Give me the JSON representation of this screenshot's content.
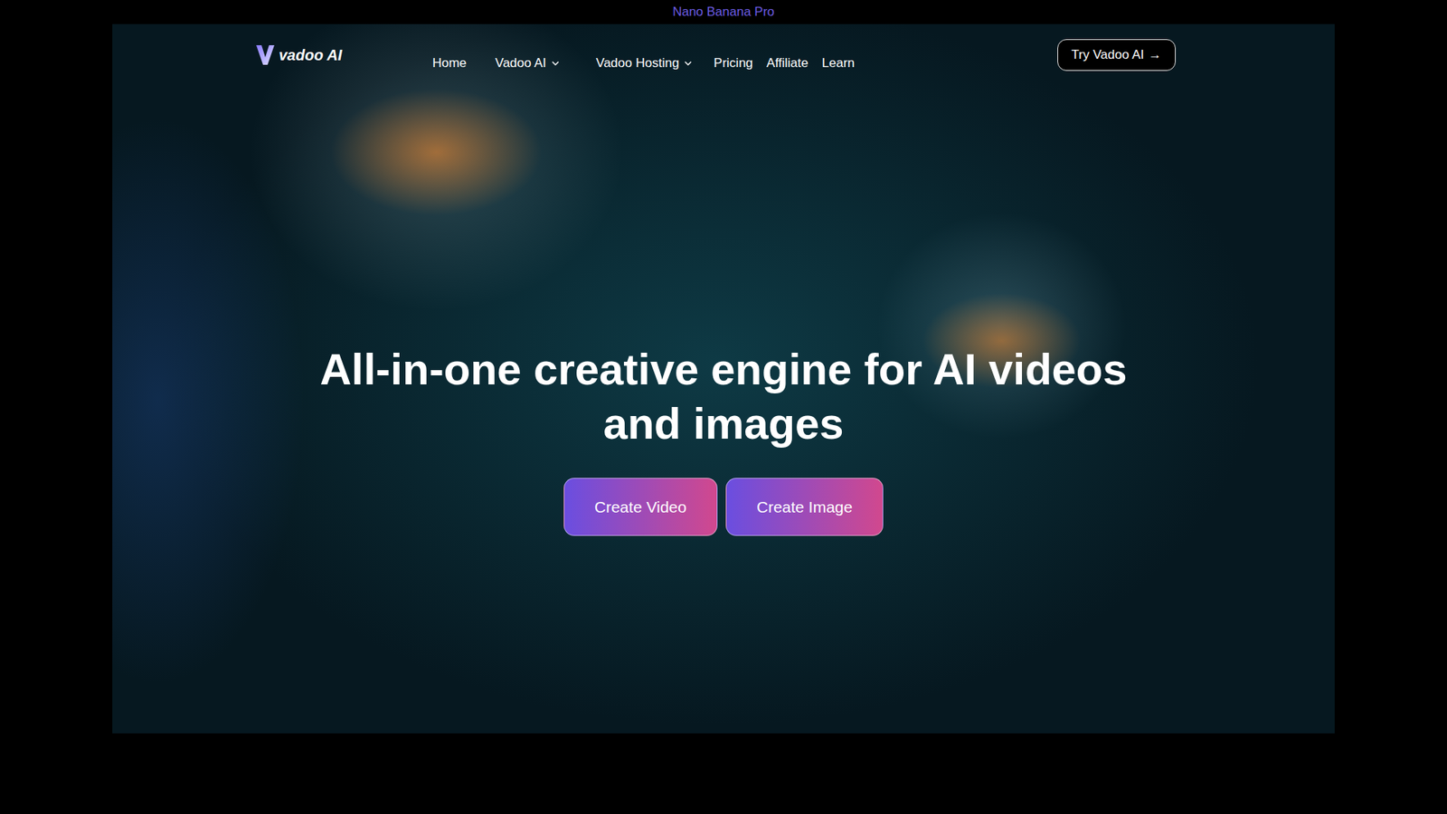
{
  "banner": {
    "text": "Nano Banana Pro"
  },
  "logo": {
    "text": "vadoo AI"
  },
  "nav": {
    "items": [
      {
        "label": "Home",
        "kind": "link"
      },
      {
        "label": "Vadoo AI",
        "kind": "dropdown"
      },
      {
        "label": "Vadoo Hosting",
        "kind": "dropdown"
      },
      {
        "label": "Pricing",
        "kind": "link"
      },
      {
        "label": "Affiliate",
        "kind": "link"
      },
      {
        "label": "Learn",
        "kind": "link"
      }
    ]
  },
  "cta": {
    "label": "Try Vadoo AI",
    "icon": "→"
  },
  "hero": {
    "title_lines": [
      "All-in-one creative engine for AI videos",
      "and images"
    ],
    "buttons": [
      "Create Video",
      "Create Image"
    ]
  }
}
